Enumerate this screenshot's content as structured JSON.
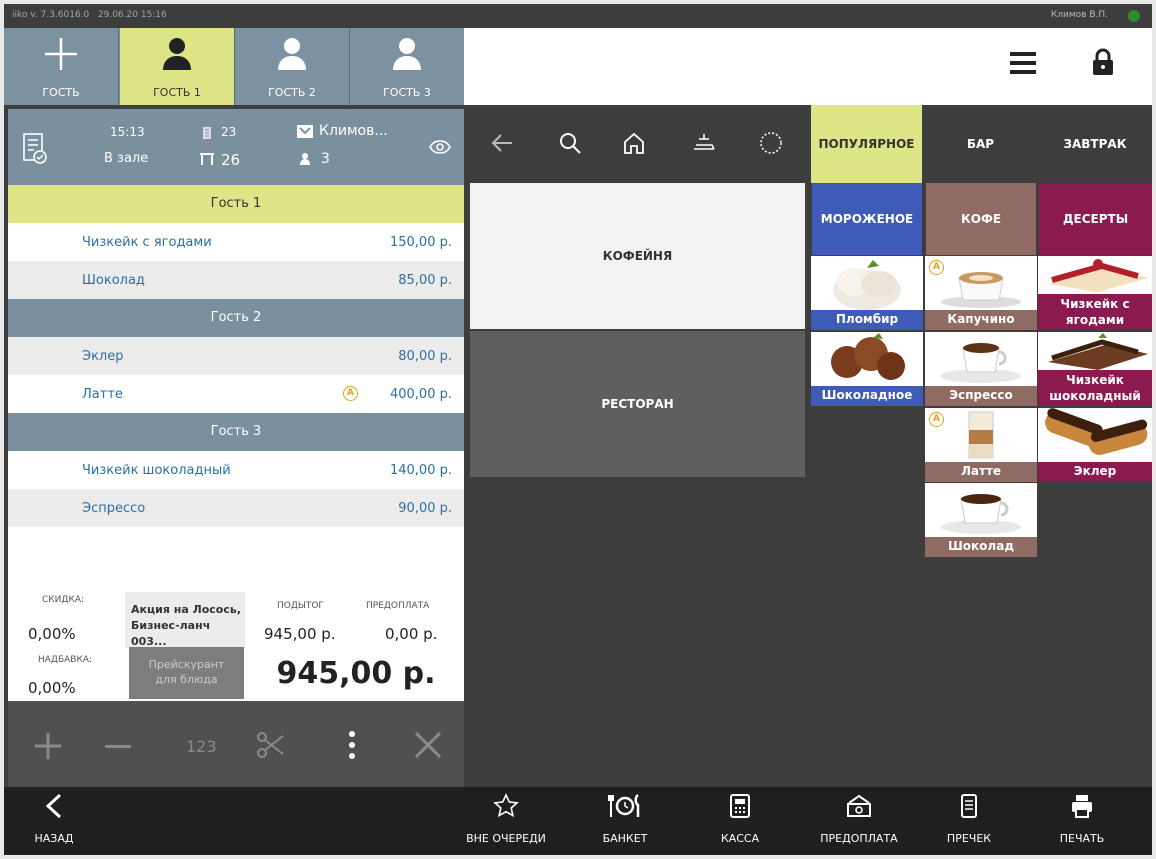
{
  "titlebar": {
    "version": "iiko v. 7.3.6016.0",
    "datetime": "29.06.20 15:16",
    "user": "Климов В.П."
  },
  "guests": {
    "add_label": "ГОСТЬ",
    "tabs": [
      "ГОСТЬ 1",
      "ГОСТЬ 2",
      "ГОСТЬ 3"
    ]
  },
  "order_header": {
    "time": "15:13",
    "location": "В зале",
    "order_no": "23",
    "table_no": "26",
    "waiter": "Климов...",
    "guest_count": "3"
  },
  "order": [
    {
      "guest": "Гость 1",
      "items": [
        {
          "name": "Чизкейк с ягодами",
          "price": "150,00 р."
        },
        {
          "name": "Шоколад",
          "price": "85,00 р."
        }
      ]
    },
    {
      "guest": "Гость 2",
      "items": [
        {
          "name": "Эклер",
          "price": "80,00 р."
        },
        {
          "name": "Латте",
          "price": "400,00 р."
        }
      ]
    },
    {
      "guest": "Гость 3",
      "items": [
        {
          "name": "Чизкейк шоколадный",
          "price": "140,00 р."
        },
        {
          "name": "Эспрессо",
          "price": "90,00 р."
        }
      ]
    }
  ],
  "warn_letter": "A",
  "totals": {
    "discount_label": "СКИДКА:",
    "discount_value": "0,00%",
    "markup_label": "НАДБАВКА:",
    "markup_value": "0,00%",
    "promo_line1": "Акция на Лосось,",
    "promo_line2": "Бизнес-ланч 003...",
    "pricelist_line1": "Прейскурант",
    "pricelist_line2": "для блюда",
    "subtotal_label": "ПОДЫТОГ",
    "subtotal_value": "945,00 р.",
    "prepay_label": "ПРЕДОПЛАТА",
    "prepay_value": "0,00 р.",
    "total": "945,00 р."
  },
  "order_actions": {
    "qty_label": "123"
  },
  "categories": {
    "popular": "ПОПУЛЯРНОЕ",
    "bar": "БАР",
    "breakfast": "ЗАВТРАК"
  },
  "menus": {
    "cafe": "КОФЕЙНЯ",
    "restaurant": "РЕСТОРАН"
  },
  "groups": {
    "icecream": "МОРОЖЕНОЕ",
    "coffee": "КОФЕ",
    "desserts": "ДЕСЕРТЫ"
  },
  "products": {
    "plombir": "Пломбир",
    "chocolate_ice": "Шоколадное",
    "cappuccino": "Капучино",
    "espresso": "Эспрессо",
    "latte": "Латте",
    "chocolate": "Шоколад",
    "cheesecake_berries": "Чизкейк с ягодами",
    "cheesecake_choco": "Чизкейк шоколадный",
    "eclair": "Эклер"
  },
  "bottom": {
    "back": "НАЗАД",
    "out_of_turn": "ВНЕ ОЧЕРЕДИ",
    "banquet": "БАНКЕТ",
    "cash": "КАССА",
    "prepay": "ПРЕДОПЛАТА",
    "precheck": "ПРЕЧЕК",
    "print": "ПЕЧАТЬ"
  },
  "colors": {
    "popular": "#dde587",
    "icecream": "#3e5bb8",
    "coffee": "#8f6b63",
    "desserts": "#8b1a4e"
  }
}
